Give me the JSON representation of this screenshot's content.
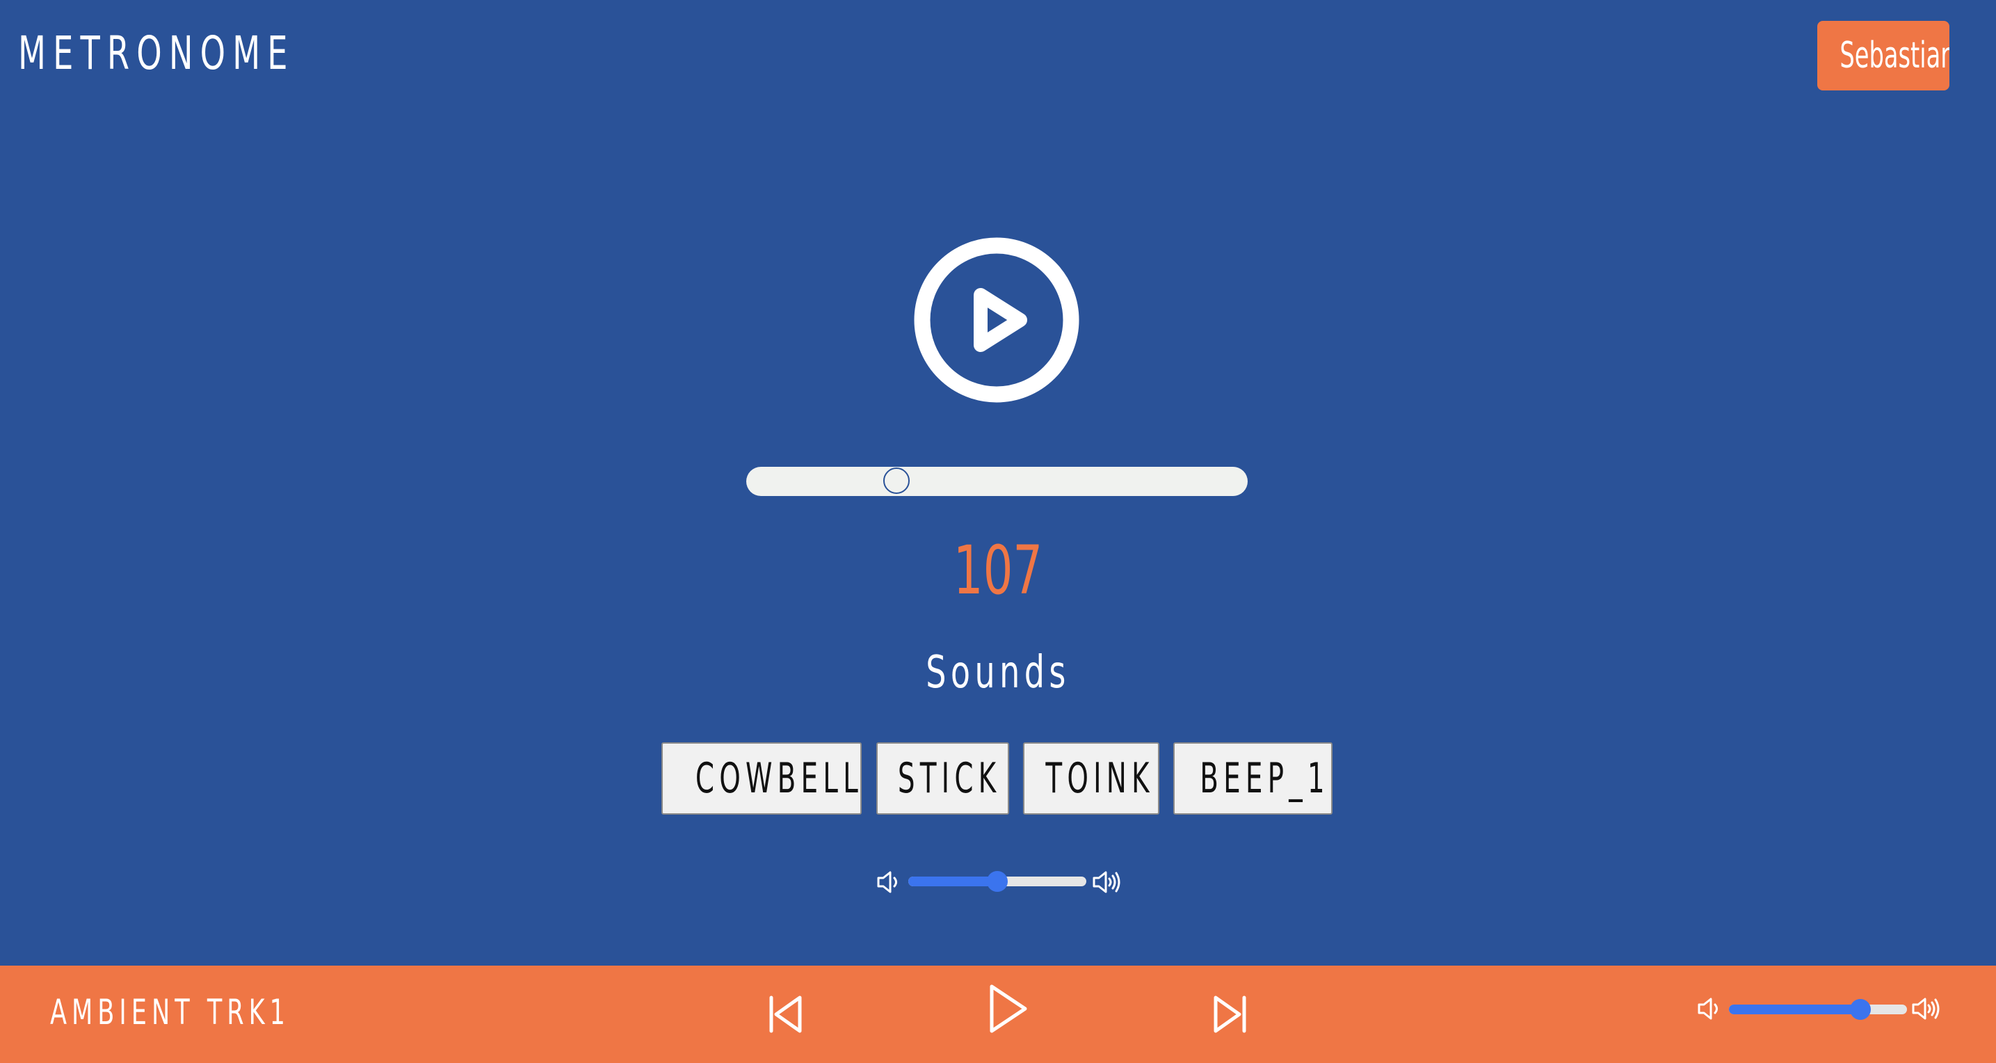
{
  "app": {
    "title": "METRONOME",
    "user_name": "Sebastian"
  },
  "metronome": {
    "bpm": "107",
    "tempo_position": 0.3,
    "sounds_title": "Sounds",
    "sounds": [
      "COWBELL",
      "STICK",
      "TOINK",
      "BEEP_1"
    ],
    "volume": 0.5
  },
  "player": {
    "track_name": "AMBIENT TRK1",
    "volume": 0.74
  },
  "colors": {
    "background": "#2a5298",
    "accent": "#ef7645",
    "slider_fill": "#3b74ee",
    "track": "#f0f2ef"
  },
  "icons": {
    "main_play": "play-circle-icon",
    "prev": "skip-back-icon",
    "play": "play-icon",
    "next": "skip-forward-icon",
    "vol_low": "volume-low-icon",
    "vol_high": "volume-high-icon"
  }
}
